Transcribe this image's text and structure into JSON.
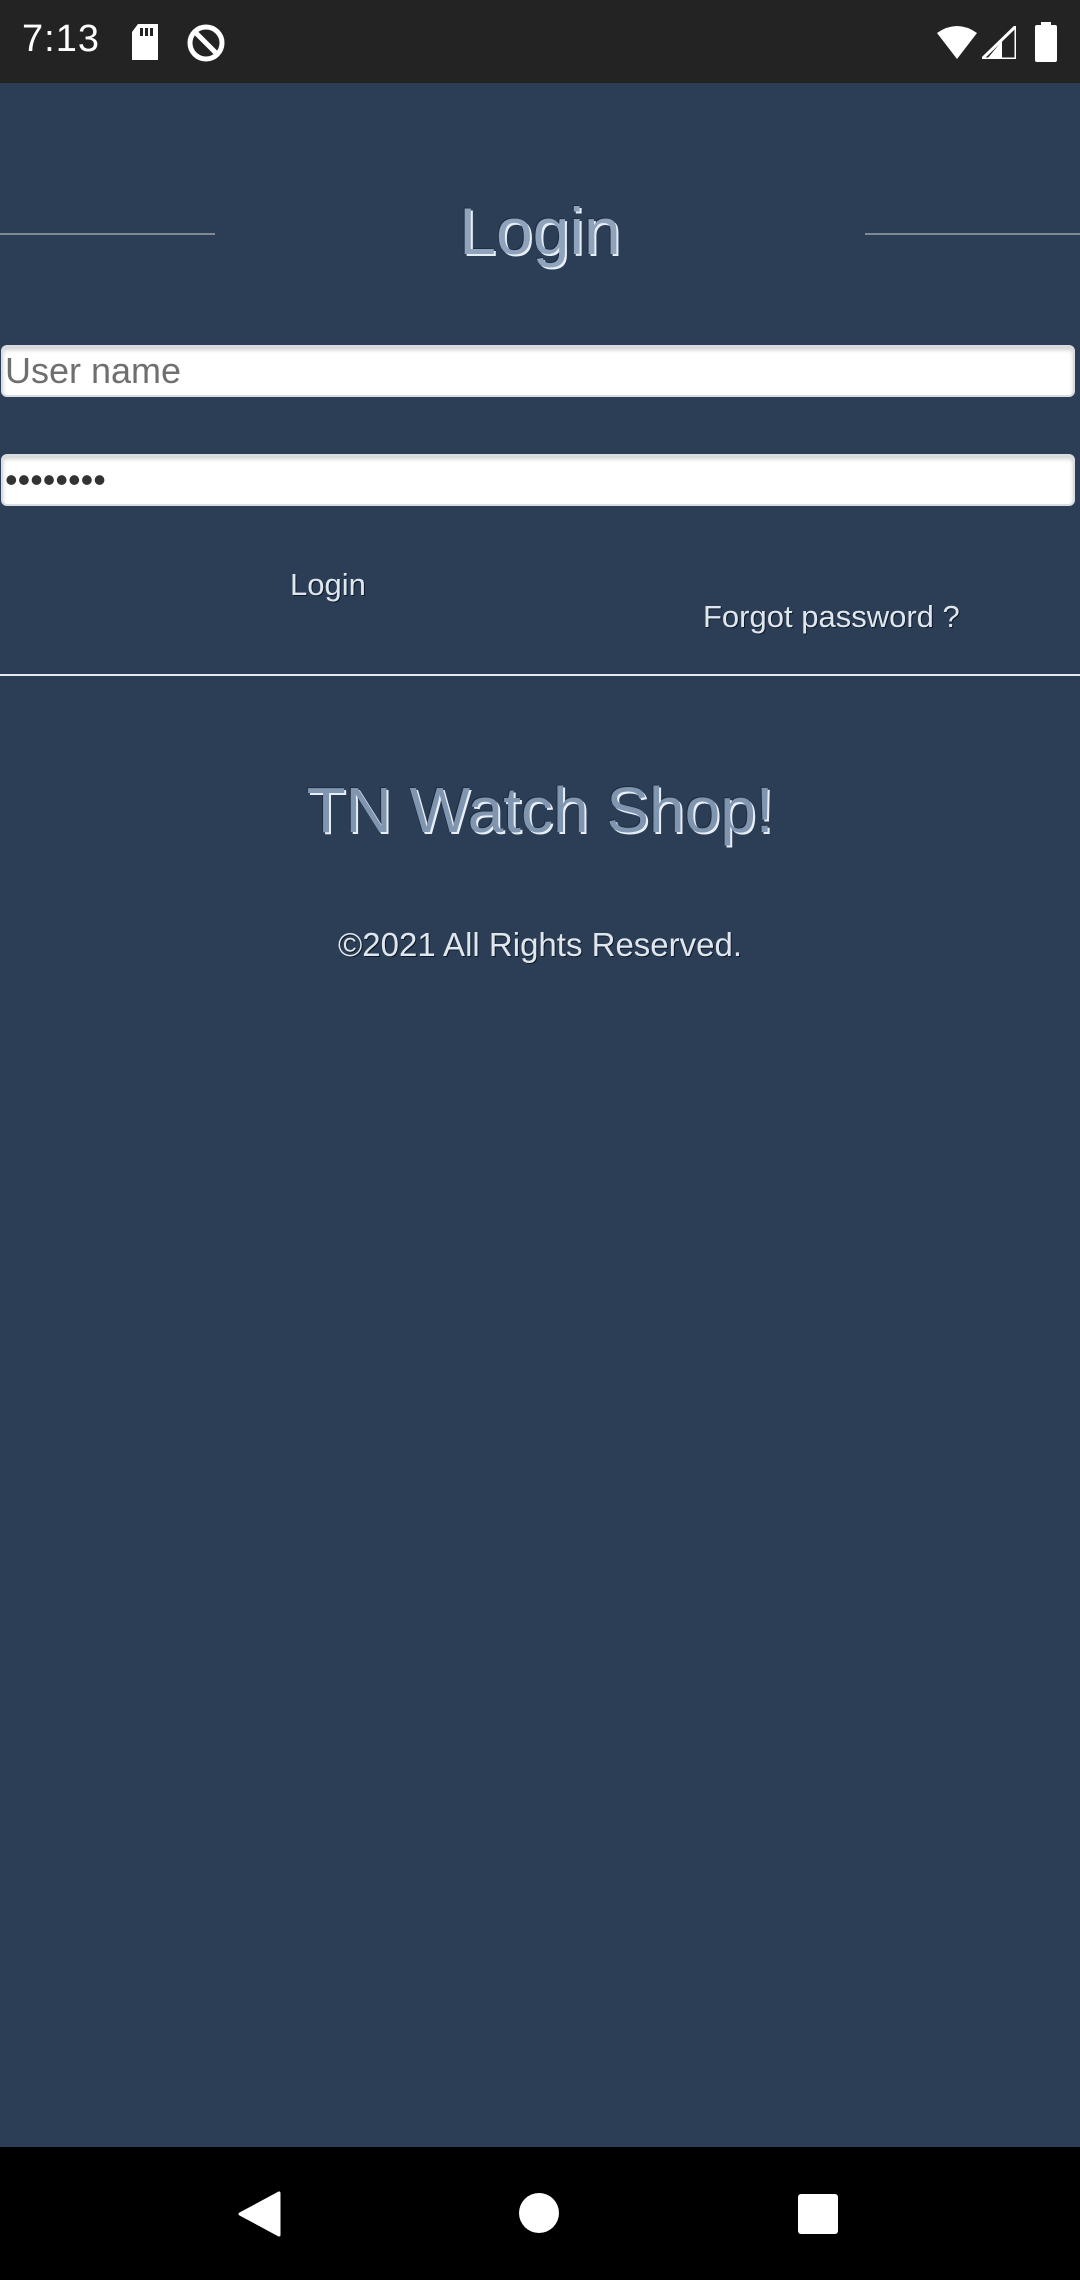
{
  "status_bar": {
    "time": "7:13",
    "icons": [
      "sd-card-icon",
      "data-saver-icon",
      "wifi-icon",
      "cellular-signal-icon",
      "battery-icon"
    ]
  },
  "login_form": {
    "title": "Login",
    "username": {
      "placeholder": "User name",
      "value": ""
    },
    "password": {
      "value": "12345678"
    },
    "login_label": "Login",
    "forgot_label": "Forgot password ?"
  },
  "footer": {
    "shop_name": "TN Watch Shop!",
    "copyright": "©2021 All Rights Reserved."
  },
  "nav_bar": {
    "buttons": [
      "back-icon",
      "home-icon",
      "recents-icon"
    ]
  },
  "colors": {
    "background": "#2c3e55",
    "status_bar": "#232323",
    "nav_bar": "#000000",
    "title_text": "#8fa3bd",
    "link_text": "#dfe6ee"
  }
}
